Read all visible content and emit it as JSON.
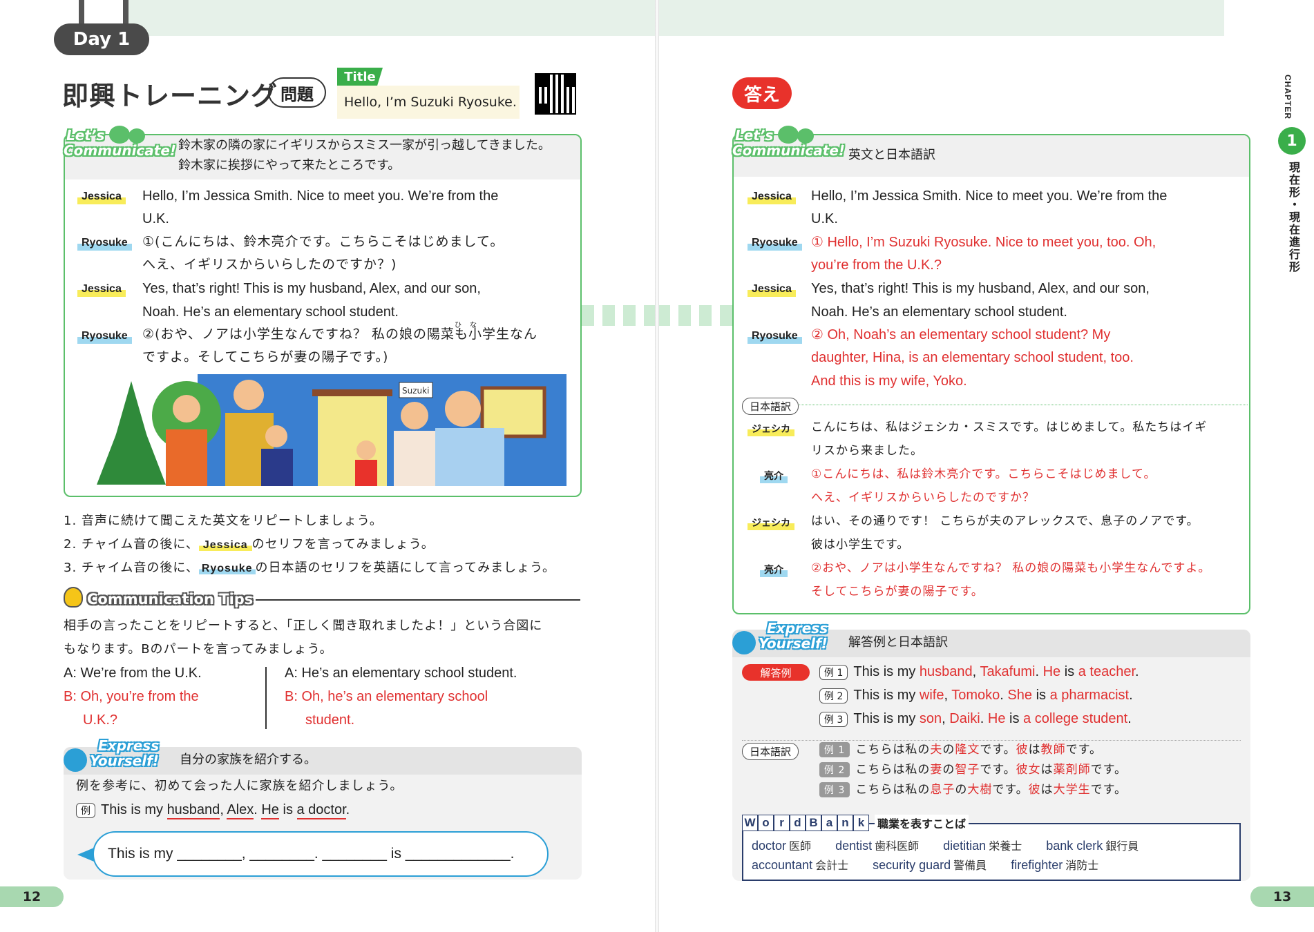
{
  "left": {
    "day": "Day 1",
    "title": "即興トレーニング",
    "mondai": "問題",
    "title_badge": "Title",
    "title_text": "Hello, I’m Suzuki Ryosuke.",
    "lets_line1": "Let’s",
    "lets_line2": "Communicate!",
    "situation_1": "鈴木家の隣の家にイギリスからスミス一家が引っ越してきました。",
    "situation_2": "鈴木家に挨拶にやって来たところです。",
    "dialogue": [
      {
        "speaker": "Jessica",
        "l1": "Hello, I’m Jessica Smith.  Nice to meet you.  We’re from the",
        "l2": "U.K."
      },
      {
        "speaker": "Ryosuke",
        "l1": "①(こんにちは、鈴木亮介です。こちらこそはじめまして。",
        "l2": "へえ、イギリスからいらしたのですか？)"
      },
      {
        "speaker": "Jessica",
        "l1": "Yes, that’s right!  This is my husband, Alex, and our son,",
        "l2": "Noah.  He’s an elementary school student."
      },
      {
        "speaker": "Ryosuke",
        "l1": "②(おや、ノアは小学生なんですね？  私の娘の陽菜も小学生なん",
        "l2": "ですよ。そしてこちらが妻の陽子です。)"
      }
    ],
    "ruby_hi": "ひ",
    "ruby_na": "な",
    "door_sign": "Suzuki",
    "instr1": "1. 音声に続けて聞こえた英文をリピートしましょう。",
    "instr2_pre": "2. チャイム音の後に、",
    "instr2_spk": "Jessica",
    "instr2_post": "のセリフを言ってみましょう。",
    "instr3_pre": "3. チャイム音の後に、",
    "instr3_spk": "Ryosuke",
    "instr3_post": "の日本語のセリフを英語にして言ってみましょう。",
    "tips_title": "Communication Tips",
    "tips_1": "相手の言ったことをリピートすると、「正しく聞き取れましたよ！」という合図に",
    "tips_2": "もなります。Bのパートを言ってみましょう。",
    "tipA1": "A: We’re from the U.K.",
    "tipB1a": "B: Oh, you’re from the",
    "tipB1b": "U.K.?",
    "tipA2": "A: He’s an elementary school student.",
    "tipB2a": "B: Oh, he’s an elementary school",
    "tipB2b": "student.",
    "expr_line1": "Express",
    "expr_line2": "Yourself!",
    "expr_task": "自分の家族を紹介する。",
    "expr_inst": "例を参考に、初めて会った人に家族を紹介しましょう。",
    "ex_tag": "例",
    "ex_pre": "This is my ",
    "ex_husband": "husband",
    "ex_comma": ", ",
    "ex_alex": "Alex",
    "ex_dot": ".  ",
    "ex_he": "He",
    "ex_is": " is ",
    "ex_doctor": "a doctor",
    "ex_end": ".",
    "speech": "This is my ________, ________.  ________ is _____________.",
    "page": "12"
  },
  "right": {
    "kotae": "答え",
    "lets_line1": "Let’s",
    "lets_line2": "Communicate!",
    "head": "英文と日本語訳",
    "dialogue": [
      {
        "speaker": "Jessica",
        "l1": "Hello, I’m Jessica Smith.  Nice to meet you.  We’re from the",
        "l2": "U.K.",
        "red": false
      },
      {
        "speaker": "Ryosuke",
        "l1": "① Hello, I’m Suzuki Ryosuke.  Nice to meet you, too.  Oh,",
        "l2": "you’re from the U.K.?",
        "red": true
      },
      {
        "speaker": "Jessica",
        "l1": "Yes, that’s right! This is my husband, Alex, and our son,",
        "l2": "Noah.  He’s an elementary school student.",
        "red": false
      },
      {
        "speaker": "Ryosuke",
        "l1": "② Oh, Noah’s an elementary school student?  My",
        "l2": "daughter, Hina, is an elementary school student, too.",
        "l3": "And this is my wife, Yoko.",
        "red": true
      }
    ],
    "nihongo_tag": "日本語訳",
    "jp": [
      {
        "speaker": "ジェシカ",
        "l1": "こんにちは、私はジェシカ・スミスです。はじめまして。私たちはイギ",
        "l2": "リスから来ました。",
        "red": false
      },
      {
        "speaker": "亮介",
        "l1": "①こんにちは、私は鈴木亮介です。こちらこそはじめまして。",
        "l2": "へえ、イギリスからいらしたのですか？",
        "red": true
      },
      {
        "speaker": "ジェシカ",
        "l1": "はい、その通りです！  こちらが夫のアレックスで、息子のノアです。",
        "l2": "彼は小学生です。",
        "red": false
      },
      {
        "speaker": "亮介",
        "l1": "②おや、ノアは小学生なんですね？  私の娘の陽菜も小学生なんですよ。",
        "l2": "そしてこちらが妻の陽子です。",
        "red": true
      }
    ],
    "expr_line1": "Express",
    "expr_line2": "Yourself!",
    "expr_head": "解答例と日本語訳",
    "kaitou": "解答例",
    "examples": [
      {
        "tag": "例 1",
        "p1": "This is my ",
        "a": "husband",
        "p2": ", ",
        "b": "Takafumi",
        "p3": ".  ",
        "c": "He",
        "p4": " is ",
        "d": "a teacher",
        "p5": "."
      },
      {
        "tag": "例 2",
        "p1": "This is my ",
        "a": "wife",
        "p2": ", ",
        "b": "Tomoko",
        "p3": ".  ",
        "c": "She",
        "p4": " is ",
        "d": "a pharmacist",
        "p5": "."
      },
      {
        "tag": "例 3",
        "p1": "This is my ",
        "a": "son",
        "p2": ", ",
        "b": "Daiki",
        "p3": ".  ",
        "c": "He",
        "p4": " is ",
        "d": "a college student",
        "p5": "."
      }
    ],
    "nihongo_tag2": "日本語訳",
    "jp_examples": [
      {
        "tag": "例 1",
        "p1": "こちらは私の",
        "a": "夫",
        "p2": "の",
        "b": "隆文",
        "p3": "です。",
        "c": "彼",
        "p4": "は",
        "d": "教師",
        "p5": "です。"
      },
      {
        "tag": "例 2",
        "p1": "こちらは私の",
        "a": "妻",
        "p2": "の",
        "b": "智子",
        "p3": "です。",
        "c": "彼女",
        "p4": "は",
        "d": "薬剤師",
        "p5": "です。"
      },
      {
        "tag": "例 3",
        "p1": "こちらは私の",
        "a": "息子",
        "p2": "の",
        "b": "大樹",
        "p3": "です。",
        "c": "彼",
        "p4": "は",
        "d": "大学生",
        "p5": "です。"
      }
    ],
    "wb_letters": [
      "W",
      "o",
      "r",
      "d",
      "B",
      "a",
      "n",
      "k"
    ],
    "wb_title": "職業を表すことば",
    "wb_row1": [
      {
        "en": "doctor",
        "jp": "医師"
      },
      {
        "en": "dentist",
        "jp": "歯科医師"
      },
      {
        "en": "dietitian",
        "jp": "栄養士"
      },
      {
        "en": "bank clerk",
        "jp": "銀行員"
      }
    ],
    "wb_row2": [
      {
        "en": "accountant",
        "jp": "会計士"
      },
      {
        "en": "security guard",
        "jp": "警備員"
      },
      {
        "en": "firefighter",
        "jp": "消防士"
      }
    ],
    "chapter": "CHAPTER",
    "chapter_num": "1",
    "chapter_title": "現在形・現在進行形",
    "page": "13"
  },
  "colors": {
    "green": "#5bbf6a",
    "red": "#e03030",
    "blue": "#2b9fd6",
    "navy": "#2a3d6b"
  }
}
